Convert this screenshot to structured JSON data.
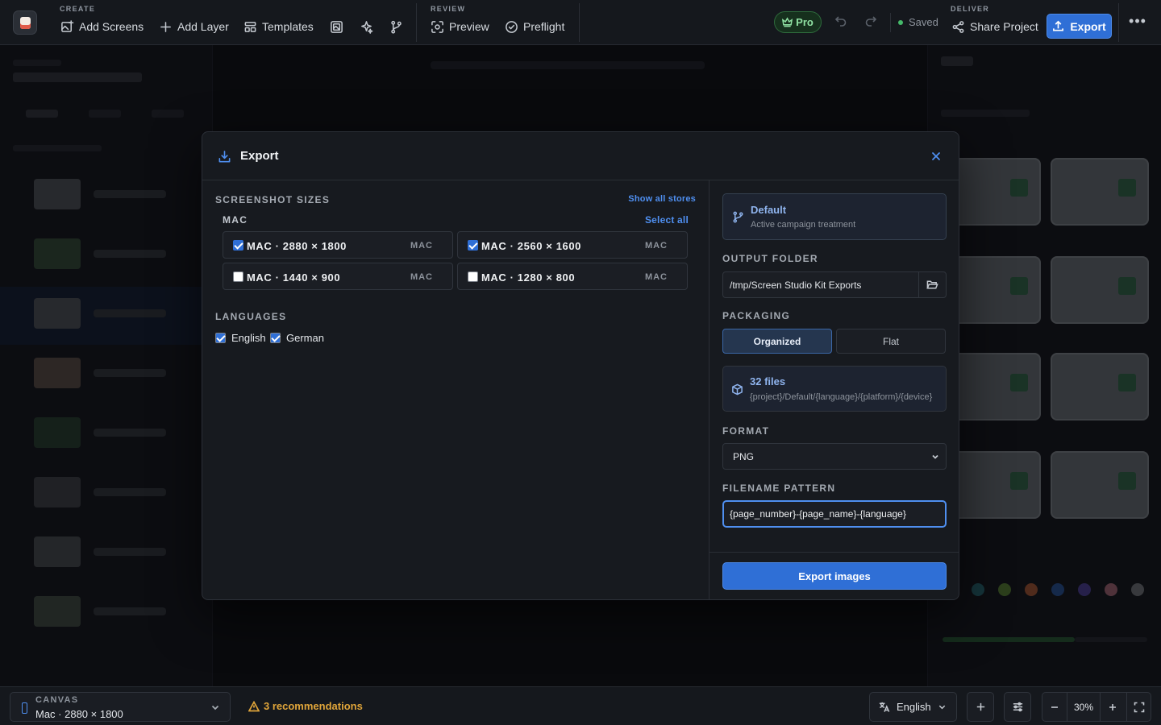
{
  "toolbar": {
    "create_label": "CREATE",
    "add_screens": "Add Screens",
    "add_layer": "Add Layer",
    "templates": "Templates",
    "review_label": "REVIEW",
    "preview": "Preview",
    "preflight": "Preflight",
    "pro": "Pro",
    "saved": "Saved",
    "deliver_label": "DELIVER",
    "share_project": "Share Project",
    "export": "Export",
    "more": "•••"
  },
  "modal": {
    "title": "Export",
    "screenshot_sizes_label": "SCREENSHOT SIZES",
    "show_all_stores": "Show all stores",
    "platform_label": "MAC",
    "select_all": "Select all",
    "sizes": [
      {
        "label": "MAC · 2880 × 1800",
        "tag": "MAC",
        "checked": true
      },
      {
        "label": "MAC · 2560 × 1600",
        "tag": "MAC",
        "checked": true
      },
      {
        "label": "MAC · 1440 × 900",
        "tag": "MAC",
        "checked": false
      },
      {
        "label": "MAC · 1280 × 800",
        "tag": "MAC",
        "checked": false
      }
    ],
    "languages_label": "LANGUAGES",
    "languages": [
      {
        "label": "English",
        "checked": true
      },
      {
        "label": "German",
        "checked": true
      }
    ],
    "campaign": {
      "title": "Default",
      "subtitle": "Active campaign treatment"
    },
    "output_folder_label": "OUTPUT FOLDER",
    "output_folder_value": "/tmp/Screen Studio Kit Exports",
    "packaging_label": "PACKAGING",
    "packaging_options": [
      "Organized",
      "Flat"
    ],
    "packaging_selected": "Organized",
    "files": {
      "count": "32 files",
      "path": "{project}/Default/{language}/{platform}/{device}"
    },
    "format_label": "FORMAT",
    "format_value": "PNG",
    "filename_pattern_label": "FILENAME PATTERN",
    "filename_pattern_value": "{page_number}-{page_name}-{language}",
    "export_images": "Export images"
  },
  "bottombar": {
    "canvas_label": "CANVAS",
    "canvas_value": "Mac · 2880 × 1800",
    "recommendations": "3 recommendations",
    "language": "English",
    "zoom": "30%"
  },
  "colors": {
    "accent": "#2f6fd6",
    "pro_green": "#8fe0a2",
    "warning": "#e0a53a"
  }
}
